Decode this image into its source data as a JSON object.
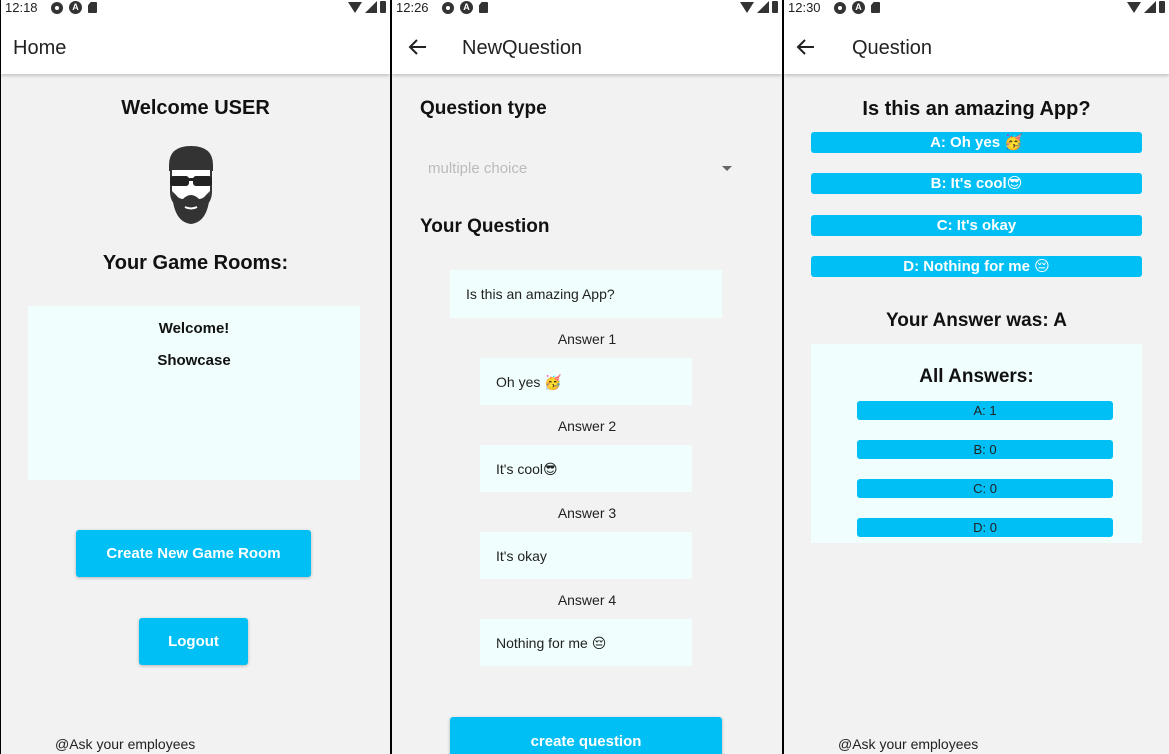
{
  "screens": [
    {
      "status_time": "12:18",
      "appbar_title": "Home",
      "welcome": "Welcome USER",
      "rooms_heading": "Your Game Rooms:",
      "rooms": [
        "Welcome!",
        "Showcase"
      ],
      "create_button": "Create New Game Room",
      "logout_button": "Logout",
      "footer": "@Ask your employees"
    },
    {
      "status_time": "12:26",
      "appbar_title": "NewQuestion",
      "question_type_heading": "Question type",
      "question_type_value": "multiple choice",
      "your_question_heading": "Your Question",
      "question_text": "Is this an amazing App?",
      "answers": [
        {
          "label": "Answer 1",
          "value": "Oh yes 🥳"
        },
        {
          "label": "Answer 2",
          "value": "It's cool😎"
        },
        {
          "label": "Answer 3",
          "value": "It's okay"
        },
        {
          "label": "Answer 4",
          "value": "Nothing for me  😔"
        }
      ],
      "create_button": "create question"
    },
    {
      "status_time": "12:30",
      "appbar_title": "Question",
      "question": "Is this an amazing App?",
      "options": [
        "A: Oh yes 🥳",
        "B: It's cool😎",
        "C: It's okay",
        "D: Nothing for me  😔"
      ],
      "your_answer": "Your Answer was: A",
      "all_answers_heading": "All Answers:",
      "results": [
        "A: 1",
        "B: 0",
        "C: 0",
        "D: 0"
      ],
      "footer": "@Ask your employees"
    }
  ],
  "colors": {
    "accent": "#00bff5",
    "panel": "#f0fffd",
    "background": "#f2f2f2"
  },
  "icons": [
    "settings-icon",
    "android-icon",
    "sd-card-icon",
    "wifi-icon",
    "signal-icon",
    "battery-icon",
    "back-arrow-icon",
    "avatar-icon",
    "dropdown-arrow-icon"
  ]
}
